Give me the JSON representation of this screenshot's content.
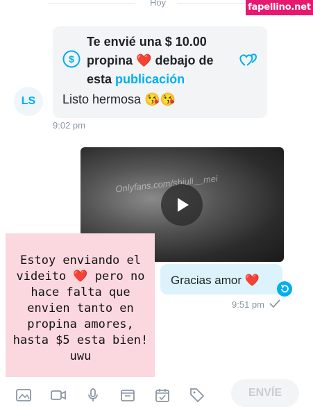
{
  "header": {
    "date_label": "Hoy"
  },
  "watermark": {
    "text": "fapellino.net"
  },
  "incoming": {
    "avatar_initials": "LS",
    "tip": {
      "line1": "Te envié una $ 10.00",
      "line2_prefix": "propina",
      "line2_heart": "❤️",
      "line2_suffix": "debajo de",
      "line3_prefix": "esta",
      "line3_link": "publicación"
    },
    "message": "Listo hermosa 😘😘",
    "time": "9:02 pm"
  },
  "video": {
    "watermark_text": "Onlyfans.com/shiuli__mei"
  },
  "outgoing": {
    "message": "Gracias amor",
    "heart": "❤️",
    "time": "9:51 pm"
  },
  "overlay_note": {
    "text": "Estoy enviando el videito ❤️ pero no hace falta que envien tanto en propina amores, hasta $5 esta bien! uwu"
  },
  "toolbar": {
    "icons": [
      "image-icon",
      "video-icon",
      "microphone-icon",
      "vault-icon",
      "calendar-icon",
      "price-tag-icon"
    ],
    "send_label": "ENVÍE"
  },
  "colors": {
    "accent": "#00aff0",
    "outgoing_bubble": "#ddf3fc",
    "incoming_bubble": "#f2f4f5",
    "overlay": "#fbd8e0",
    "watermark": "#e6186f"
  }
}
